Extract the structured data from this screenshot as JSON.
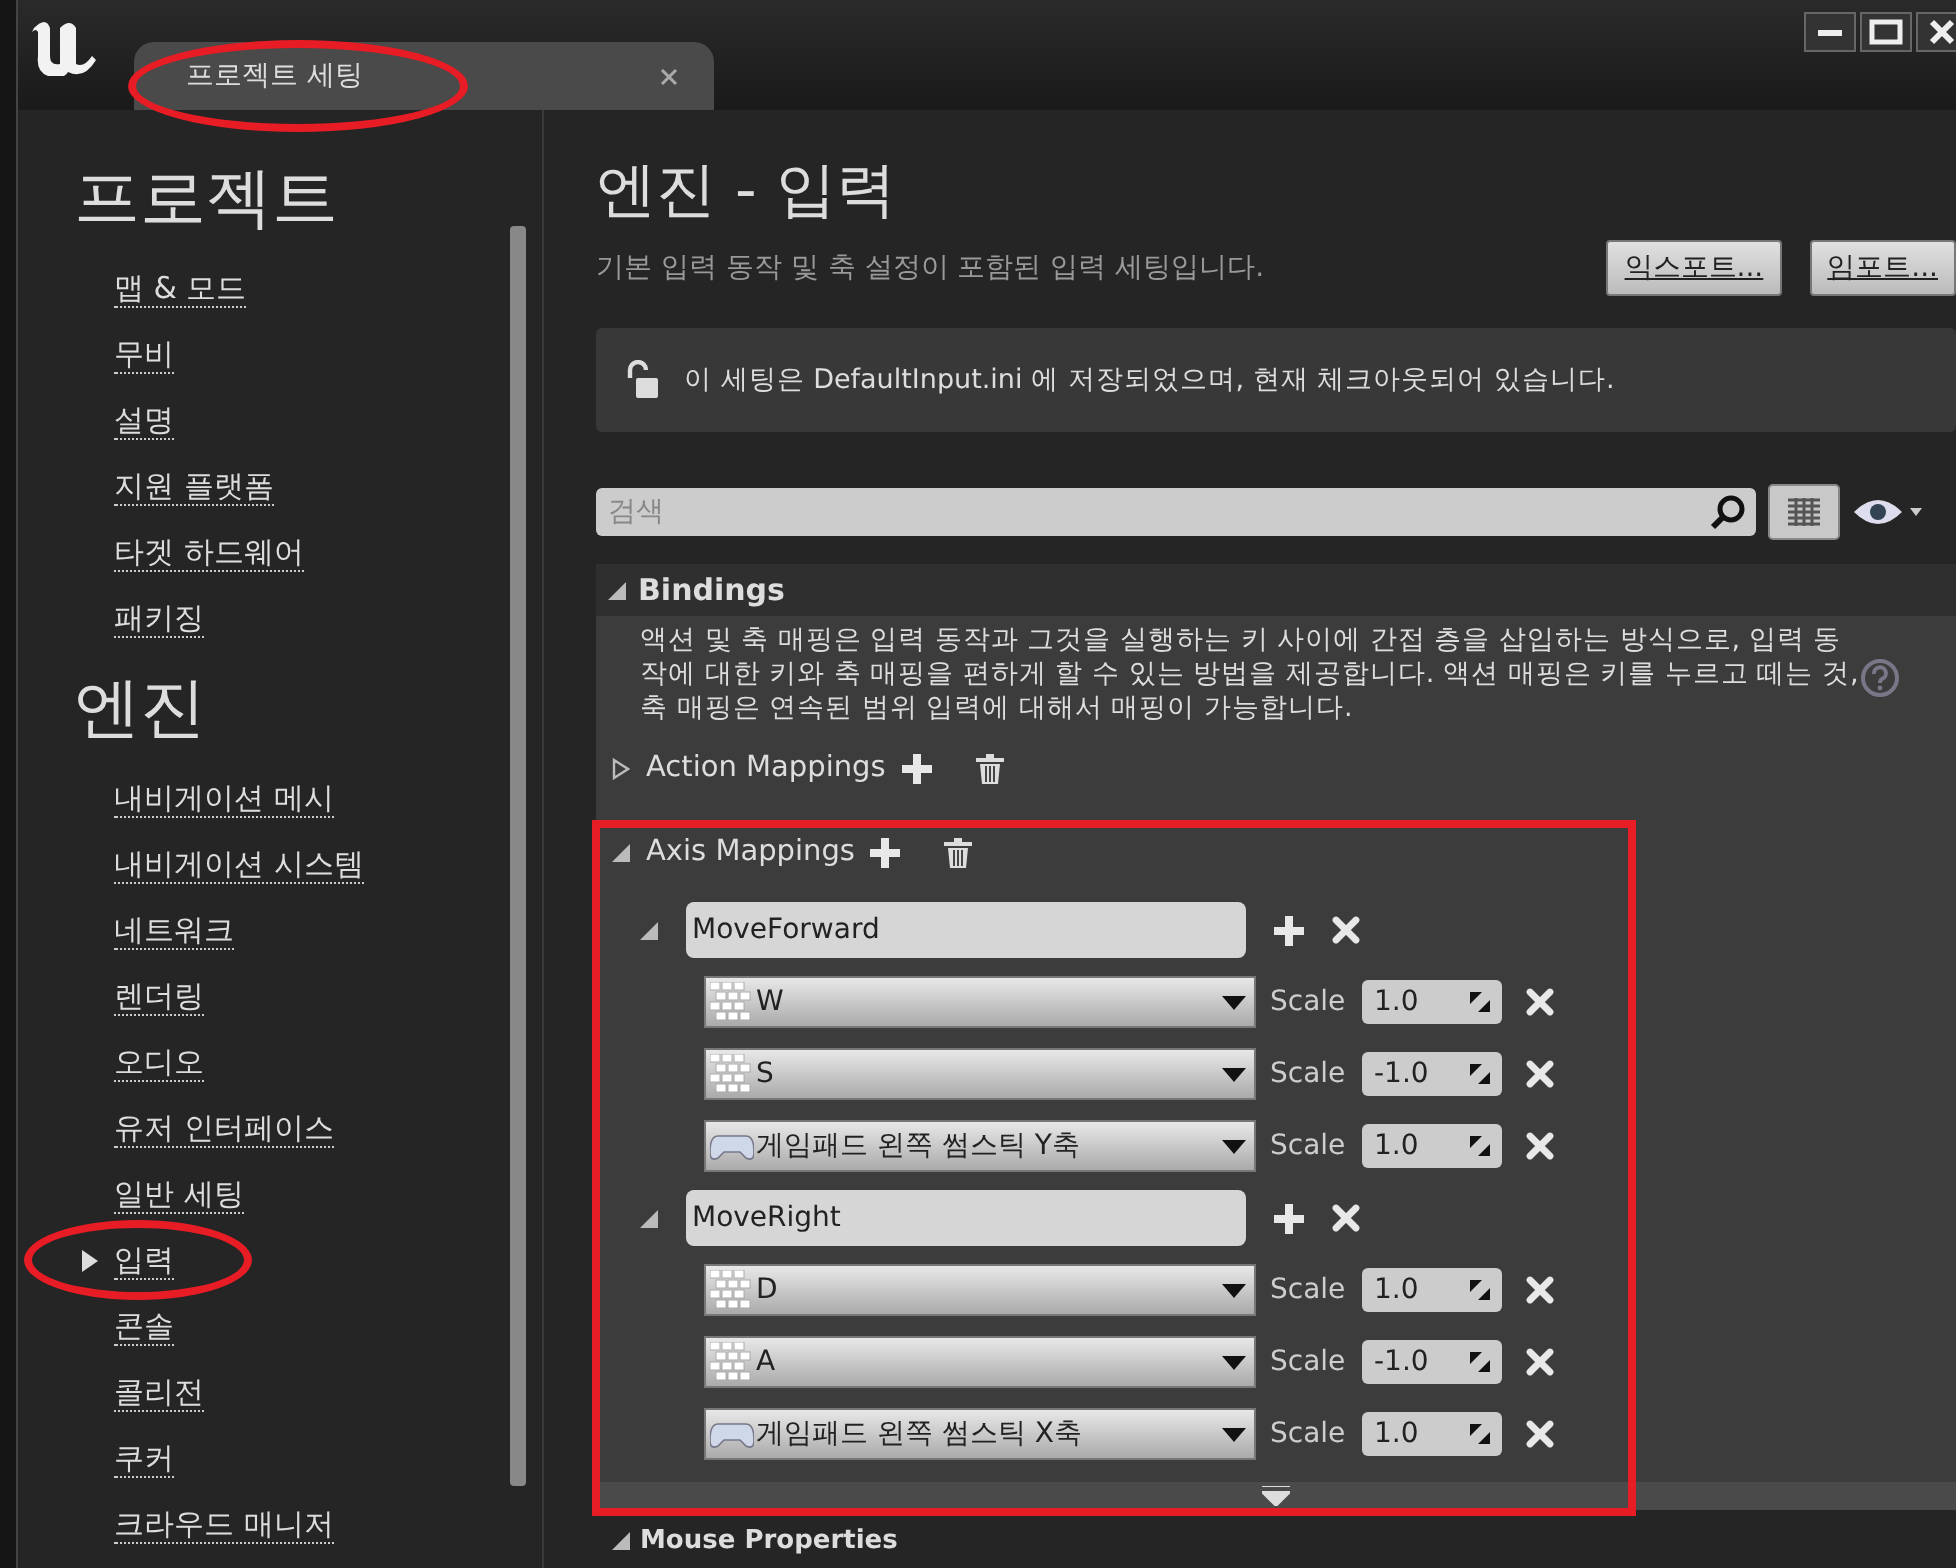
{
  "window": {
    "tab_title": "프로젝트 세팅"
  },
  "sidebar": {
    "sections": [
      {
        "title": "프로젝트",
        "items": [
          {
            "label": "맵 & 모드",
            "selected": false
          },
          {
            "label": "무비",
            "selected": false
          },
          {
            "label": "설명",
            "selected": false
          },
          {
            "label": "지원 플랫폼",
            "selected": false
          },
          {
            "label": "타겟 하드웨어",
            "selected": false
          },
          {
            "label": "패키징",
            "selected": false
          }
        ]
      },
      {
        "title": "엔진",
        "items": [
          {
            "label": "내비게이션 메시",
            "selected": false
          },
          {
            "label": "내비게이션 시스템",
            "selected": false
          },
          {
            "label": "네트워크",
            "selected": false
          },
          {
            "label": "렌더링",
            "selected": false
          },
          {
            "label": "오디오",
            "selected": false
          },
          {
            "label": "유저 인터페이스",
            "selected": false
          },
          {
            "label": "일반 세팅",
            "selected": false
          },
          {
            "label": "입력",
            "selected": true
          },
          {
            "label": "콘솔",
            "selected": false
          },
          {
            "label": "콜리전",
            "selected": false
          },
          {
            "label": "쿠커",
            "selected": false
          },
          {
            "label": "크라우드 매니저",
            "selected": false
          }
        ]
      }
    ]
  },
  "page": {
    "title": "엔진 - 입력",
    "subtitle": "기본 입력 동작 및 축 설정이 포함된 입력 세팅입니다.",
    "buttons": [
      "익스포트...",
      "임포트..."
    ],
    "notice": "이 세팅은 DefaultInput.ini 에 저장되었으며, 현재 체크아웃되어 있습니다.",
    "search": {
      "placeholder": "검색"
    }
  },
  "bindings": {
    "title": "Bindings",
    "expanded": true,
    "description": "액션 및 축 매핑은 입력 동작과 그것을 실행하는 키 사이에 간접 층을 삽입하는 방식으로, 입력 동작에 대한 키와 축 매핑을 편하게 할 수 있는 방법을 제공합니다. 액션 매핑은 키를 누르고 떼는 것, 축 매핑은 연속된 범위 입력에 대해서 매핑이 가능합니다.",
    "groups": [
      {
        "title": "Action Mappings",
        "expanded": false
      },
      {
        "title": "Axis Mappings",
        "expanded": true,
        "mappings": [
          {
            "name": "MoveForward",
            "expanded": true,
            "keys": [
              {
                "key": "W",
                "kind": "keyboard",
                "scale_label": "Scale",
                "scale": "1.0"
              },
              {
                "key": "S",
                "kind": "keyboard",
                "scale_label": "Scale",
                "scale": "-1.0"
              },
              {
                "key": "게임패드 왼쪽 썸스틱 Y축",
                "kind": "gamepad",
                "scale_label": "Scale",
                "scale": "1.0"
              }
            ]
          },
          {
            "name": "MoveRight",
            "expanded": true,
            "keys": [
              {
                "key": "D",
                "kind": "keyboard",
                "scale_label": "Scale",
                "scale": "1.0"
              },
              {
                "key": "A",
                "kind": "keyboard",
                "scale_label": "Scale",
                "scale": "-1.0"
              },
              {
                "key": "게임패드 왼쪽 썸스틱 X축",
                "kind": "gamepad",
                "scale_label": "Scale",
                "scale": "1.0"
              }
            ]
          }
        ]
      }
    ]
  },
  "next_section": {
    "title": "Mouse Properties",
    "expanded": true
  }
}
